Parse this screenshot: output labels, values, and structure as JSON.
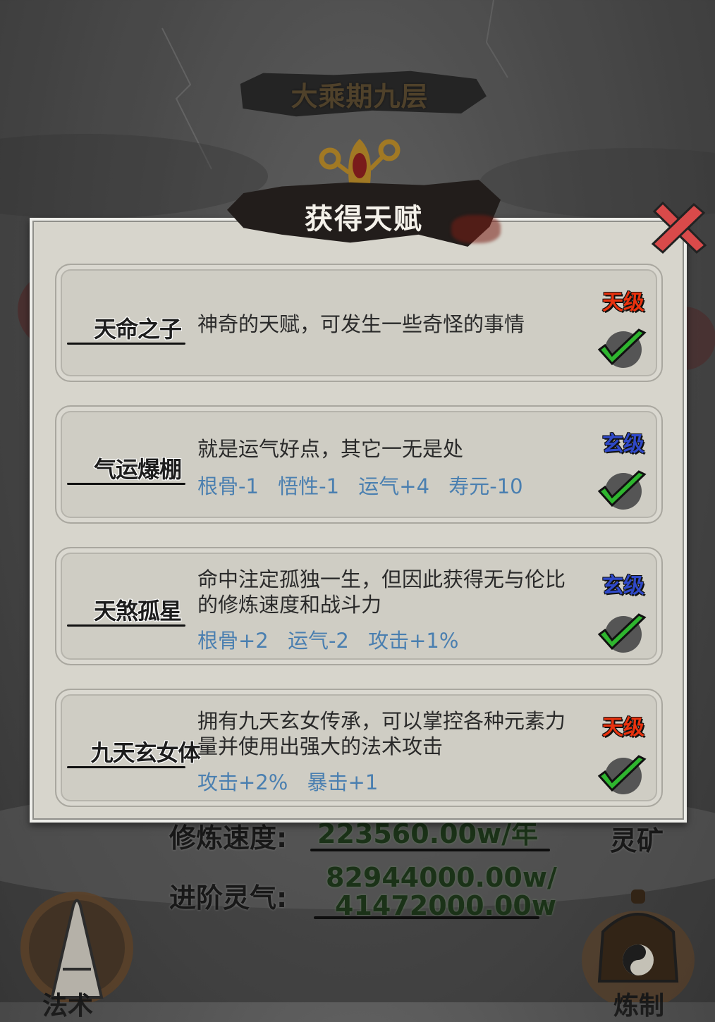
{
  "header": {
    "realm_title": "大乘期九层"
  },
  "background_stats": {
    "cultivation_speed_label": "修炼速度:",
    "cultivation_speed_value": "223560.00w/年",
    "spirit_mine_label": "灵矿",
    "advance_qi_label": "进阶灵气:",
    "advance_qi_value_line1": "82944000.00w/",
    "advance_qi_value_line2": "41472000.00w",
    "left_button_label": "法术",
    "right_button_label": "炼制"
  },
  "dialog": {
    "title": "获得天赋",
    "close_icon": "close-x-icon",
    "talents": [
      {
        "name": "天命之子",
        "desc": "神奇的天赋，可发生一些奇怪的事情",
        "grade": "天级",
        "grade_type": "heaven",
        "stats": []
      },
      {
        "name": "气运爆棚",
        "desc": "就是运气好点，其它一无是处",
        "grade": "玄级",
        "grade_type": "mystic",
        "stats": [
          "根骨-1",
          "悟性-1",
          "运气+4",
          "寿元-10"
        ]
      },
      {
        "name": "天煞孤星",
        "desc": "命中注定孤独一生，但因此获得无与伦比的修炼速度和战斗力",
        "grade": "玄级",
        "grade_type": "mystic",
        "stats": [
          "根骨+2",
          "运气-2",
          "攻击+1%"
        ]
      },
      {
        "name": "九天玄女体",
        "desc": "拥有九天玄女传承，可以掌控各种元素力量并使用出强大的法术攻击",
        "grade": "天级",
        "grade_type": "heaven",
        "stats": [
          "攻击+2%",
          "暴击+1"
        ]
      }
    ]
  },
  "colors": {
    "heaven_grade": "#e9320e",
    "mystic_grade": "#2f49c9",
    "stat_text": "#4a7fb0",
    "check_green": "#2fb52f"
  }
}
